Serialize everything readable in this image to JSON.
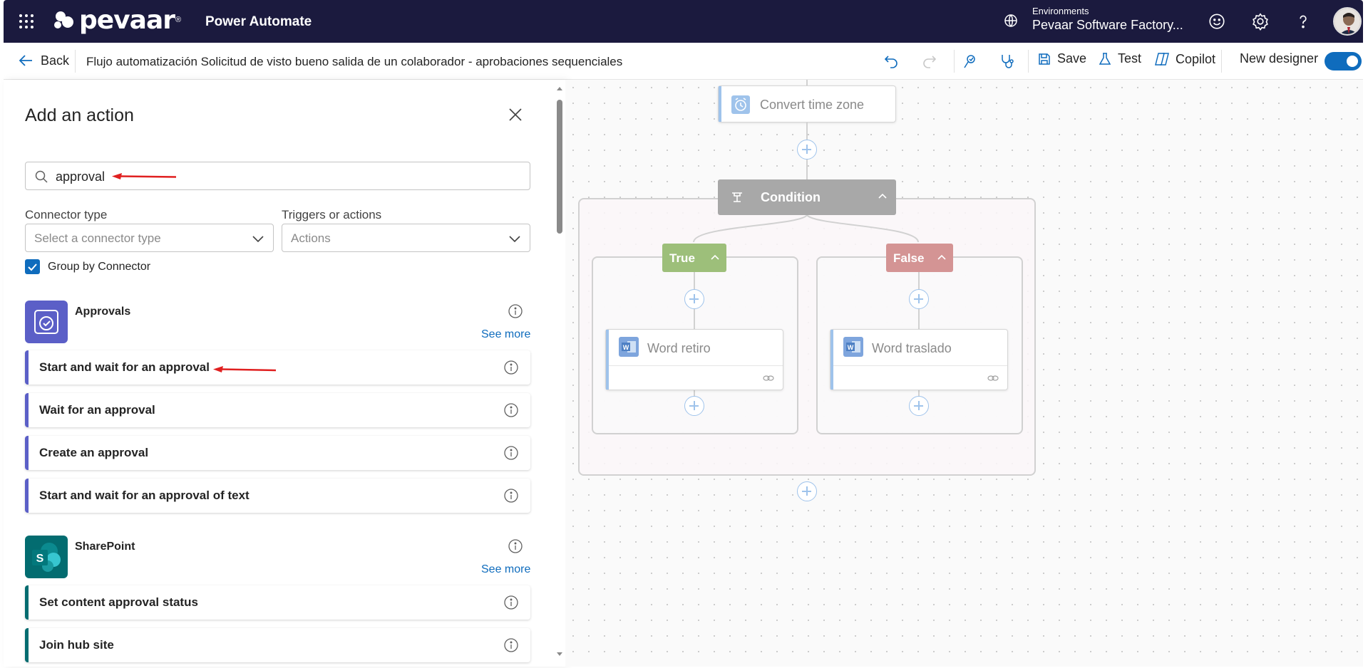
{
  "topbar": {
    "logo_text": "pevaar",
    "logo_mark": "®",
    "app_name": "Power Automate",
    "env_label": "Environments",
    "env_name": "Pevaar Software Factory..."
  },
  "commandbar": {
    "back_label": "Back",
    "flow_title": "Flujo automatización Solicitud de visto bueno salida de un colaborador - aprobaciones sequenciales",
    "save_label": "Save",
    "test_label": "Test",
    "copilot_label": "Copilot",
    "new_designer_label": "New designer",
    "new_designer_on": true
  },
  "panel": {
    "title": "Add an action",
    "search_value": "approval",
    "connector_type_label": "Connector type",
    "connector_type_placeholder": "Select a connector type",
    "triggers_label": "Triggers or actions",
    "triggers_value": "Actions",
    "group_by_label": "Group by Connector",
    "group_by_checked": true,
    "connectors": [
      {
        "name": "Approvals",
        "see_more": "See more",
        "icon": "approvals-icon",
        "color": "#5b5fc7",
        "actions": [
          "Start and wait for an approval",
          "Wait for an approval",
          "Create an approval",
          "Start and wait for an approval of text"
        ]
      },
      {
        "name": "SharePoint",
        "see_more": "See more",
        "icon": "sharepoint-icon",
        "color": "#036c70",
        "actions": [
          "Set content approval status",
          "Join hub site"
        ]
      }
    ]
  },
  "canvas": {
    "convert_node": "Convert time zone",
    "condition_label": "Condition",
    "true_label": "True",
    "false_label": "False",
    "true_action": "Word retiro",
    "false_action": "Word traslado",
    "true_color": "#9dbf7a",
    "false_color": "#d49494"
  },
  "colors": {
    "topbar_bg": "#1b1a3e",
    "accent": "#0f6cbd",
    "annotation_arrow": "#e02020"
  }
}
